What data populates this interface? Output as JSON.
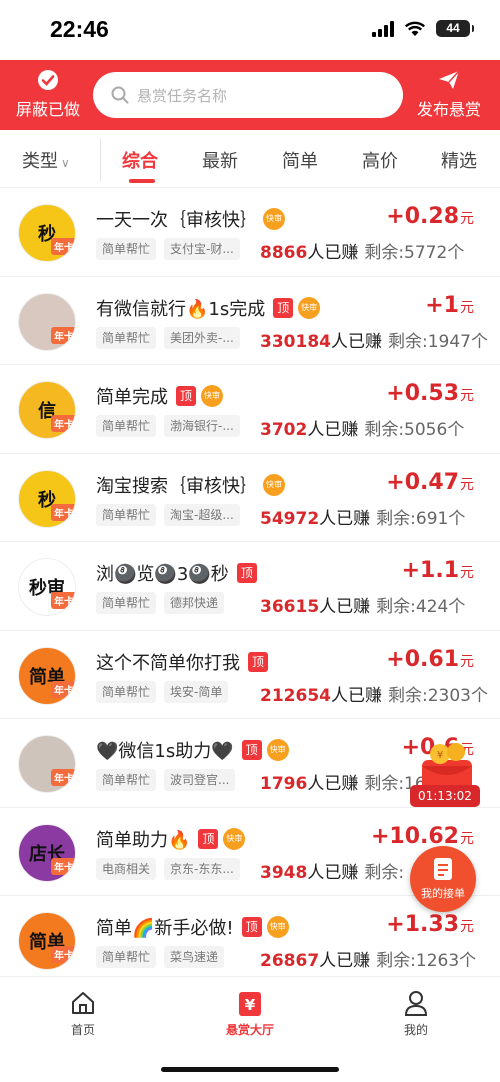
{
  "status_bar": {
    "time": "22:46",
    "battery": "44"
  },
  "header": {
    "block_label": "屏蔽已做",
    "search_placeholder": "悬赏任务名称",
    "publish_label": "发布悬赏"
  },
  "filter": {
    "type_label": "类型",
    "tabs": [
      "综合",
      "最新",
      "简单",
      "高价",
      "精选"
    ],
    "active_tab": "综合"
  },
  "badges": {
    "top": "顶",
    "fast": "快审",
    "annual": "年卡"
  },
  "tasks": [
    {
      "title": "一天一次｛审核快｝",
      "top": false,
      "fast": true,
      "cat": "简单帮忙",
      "sub": "支付宝-财...",
      "count": "8866",
      "earned_suffix": "人已赚",
      "remain": "剩余:5772个",
      "reward": "+0.28",
      "unit": "元",
      "avatar": "秒",
      "avatar_color": "#f5c518"
    },
    {
      "title": "有微信就行🔥1s完成",
      "top": true,
      "fast": true,
      "cat": "简单帮忙",
      "sub": "美团外卖-...",
      "count": "330184",
      "earned_suffix": "人已赚",
      "remain": "剩余:1947个",
      "reward": "+1",
      "unit": "元",
      "avatar": "",
      "avatar_color": "#d9c8c0"
    },
    {
      "title": "简单完成",
      "top": true,
      "fast": true,
      "cat": "简单帮忙",
      "sub": "渤海银行-...",
      "count": "3702",
      "earned_suffix": "人已赚",
      "remain": "剩余:5056个",
      "reward": "+0.53",
      "unit": "元",
      "avatar": "信",
      "avatar_color": "#f5b820"
    },
    {
      "title": "淘宝搜索｛审核快｝",
      "top": false,
      "fast": true,
      "cat": "简单帮忙",
      "sub": "淘宝-超级...",
      "count": "54972",
      "earned_suffix": "人已赚",
      "remain": "剩余:691个",
      "reward": "+0.47",
      "unit": "元",
      "avatar": "秒",
      "avatar_color": "#f5c518"
    },
    {
      "title": "浏🎱览🎱3🎱秒",
      "top": true,
      "fast": false,
      "cat": "简单帮忙",
      "sub": "德邦快递",
      "count": "36615",
      "earned_suffix": "人已赚",
      "remain": "剩余:424个",
      "reward": "+1.1",
      "unit": "元",
      "avatar": "秒审",
      "avatar_color": "#ffffff"
    },
    {
      "title": "这个不简单你打我",
      "top": true,
      "fast": false,
      "cat": "简单帮忙",
      "sub": "埃安-简单",
      "count": "212654",
      "earned_suffix": "人已赚",
      "remain": "剩余:2303个",
      "reward": "+0.61",
      "unit": "元",
      "avatar": "简单",
      "avatar_color": "#f47a20"
    },
    {
      "title": "🖤微信1s助力🖤",
      "top": true,
      "fast": true,
      "cat": "简单帮忙",
      "sub": "波司登官...",
      "count": "1796",
      "earned_suffix": "人已赚",
      "remain": "剩余:16",
      "reward": "+0.6",
      "unit": "元",
      "avatar": "",
      "avatar_color": "#cfc4bc"
    },
    {
      "title": "简单助力🔥",
      "top": true,
      "fast": true,
      "cat": "电商相关",
      "sub": "京东-东东...",
      "count": "3948",
      "earned_suffix": "人已赚",
      "remain": "剩余:",
      "reward": "+10.62",
      "unit": "元",
      "avatar": "店长",
      "avatar_color": "#8a3aa0"
    },
    {
      "title": "简单🌈新手必做!",
      "top": true,
      "fast": true,
      "cat": "简单帮忙",
      "sub": "菜鸟速递",
      "count": "26867",
      "earned_suffix": "人已赚",
      "remain": "剩余:1263个",
      "reward": "+1.33",
      "unit": "元",
      "avatar": "简单",
      "avatar_color": "#f47a20"
    }
  ],
  "floating": {
    "timer": "01:13:02",
    "my_orders": "我的接单"
  },
  "bottom_nav": [
    {
      "label": "首页",
      "icon": "home-icon",
      "active": false
    },
    {
      "label": "悬赏大厅",
      "icon": "reward-hall-icon",
      "active": true
    },
    {
      "label": "我的",
      "icon": "user-icon",
      "active": false
    }
  ],
  "colors": {
    "brand_red": "#f0383c",
    "price_red": "#d9282c"
  }
}
